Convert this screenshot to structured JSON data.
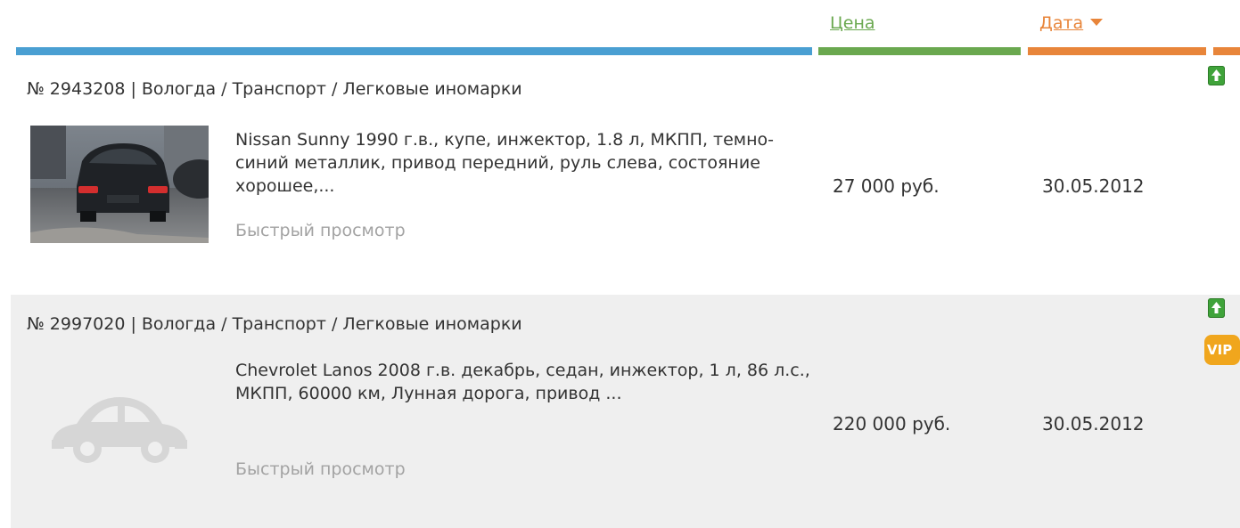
{
  "header": {
    "price_sort_label": "Цена",
    "date_sort_label": "Дата",
    "date_sort_direction": "descending",
    "colors": {
      "main": "#4a9fd2",
      "price": "#6aa84f",
      "date": "#e8853a"
    }
  },
  "listings": [
    {
      "breadcrumb": "№ 2943208 | Вологда / Транспорт / Легковые иномарки",
      "description": "Nissan Sunny 1990 г.в., купе, инжектор, 1.8 л, МКПП, темно-синий металлик, привод передний, руль слева, состояние хорошее,...",
      "quick_view": "Быстрый просмотр",
      "price": "27 000 руб.",
      "date": "30.05.2012",
      "image": "car-photo",
      "badges": [
        "up-icon"
      ]
    },
    {
      "breadcrumb": "№ 2997020 | Вологда / Транспорт / Легковые иномарки",
      "description": "Chevrolet Lanos 2008 г.в. декабрь, седан, инжектор, 1 л, 86 л.с., МКПП, 60000 км, Лунная дорога, привод ...",
      "quick_view": "Быстрый просмотр",
      "price": "220 000 руб.",
      "date": "30.05.2012",
      "image": "car-placeholder-icon",
      "badges": [
        "up-icon",
        "vip-badge"
      ],
      "vip_label": "VIP"
    }
  ]
}
